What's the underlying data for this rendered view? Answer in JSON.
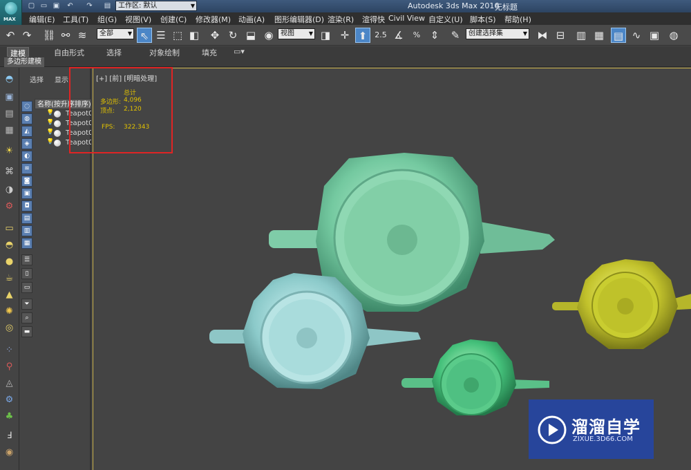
{
  "app": {
    "title": "Autodesk 3ds Max 2016",
    "file": "无标题",
    "logo_text": "MAX",
    "workspace_label": "工作区: 默认"
  },
  "menu": [
    "编辑(E)",
    "工具(T)",
    "组(G)",
    "视图(V)",
    "创建(C)",
    "修改器(M)",
    "动画(A)",
    "图形编辑器(D)",
    "渲染(R)",
    "渲得快",
    "Civil View",
    "自定义(U)",
    "脚本(S)",
    "帮助(H)"
  ],
  "toolbar": {
    "selection_filter": "全部",
    "ref_coord": "视图",
    "snap_angle": "2.5",
    "percent_snap": "%",
    "named_selection_placeholder": "创建选择集"
  },
  "ribbon": {
    "tabs": [
      "建模",
      "自由形式",
      "选择",
      "对象绘制",
      "填充"
    ],
    "active_tab": "建模",
    "sub_panel": "多边形建模"
  },
  "explorer": {
    "tabs": [
      "选择",
      "显示"
    ],
    "column_header": "名称(按升序排序)",
    "items": [
      "Teapot0",
      "Teapot0",
      "Teapot0",
      "Teapot0"
    ]
  },
  "viewport": {
    "label": "[+] [前] [明暗处理]",
    "stats": {
      "total_label": "总计",
      "polys_label": "多边形:",
      "polys_value": "4,096",
      "verts_label": "顶点:",
      "verts_value": "2,120",
      "fps_label": "FPS:",
      "fps_value": "322.343"
    },
    "highlight_color": "#e02424"
  },
  "watermark": {
    "title": "溜溜自学",
    "url": "ZIXUE.3D66.COM"
  },
  "colors": {
    "accent": "#4b86c7",
    "viewport_border": "#c9b14a",
    "stats_text": "#e2c200"
  }
}
